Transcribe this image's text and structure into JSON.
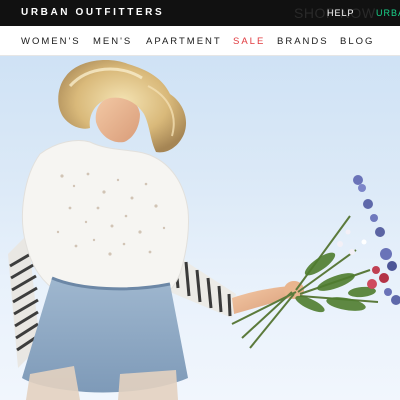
{
  "header": {
    "brand": "URBAN OUTFITTERS",
    "shop_ghost": "SHOP NOW",
    "help": "HELP",
    "urban_link": "URBAN"
  },
  "nav": {
    "items": [
      {
        "label": "WOMEN'S"
      },
      {
        "label": "MEN'S"
      },
      {
        "label": "APARTMENT"
      },
      {
        "label": "SALE"
      },
      {
        "label": "BRANDS"
      },
      {
        "label": "BLOG"
      }
    ]
  },
  "colors": {
    "topbar": "#111111",
    "accent_link": "#19d38a",
    "sale": "#e0393e",
    "sky": "#dbe9f7"
  },
  "hero": {
    "image_subject": "woman-holding-wildflowers"
  }
}
